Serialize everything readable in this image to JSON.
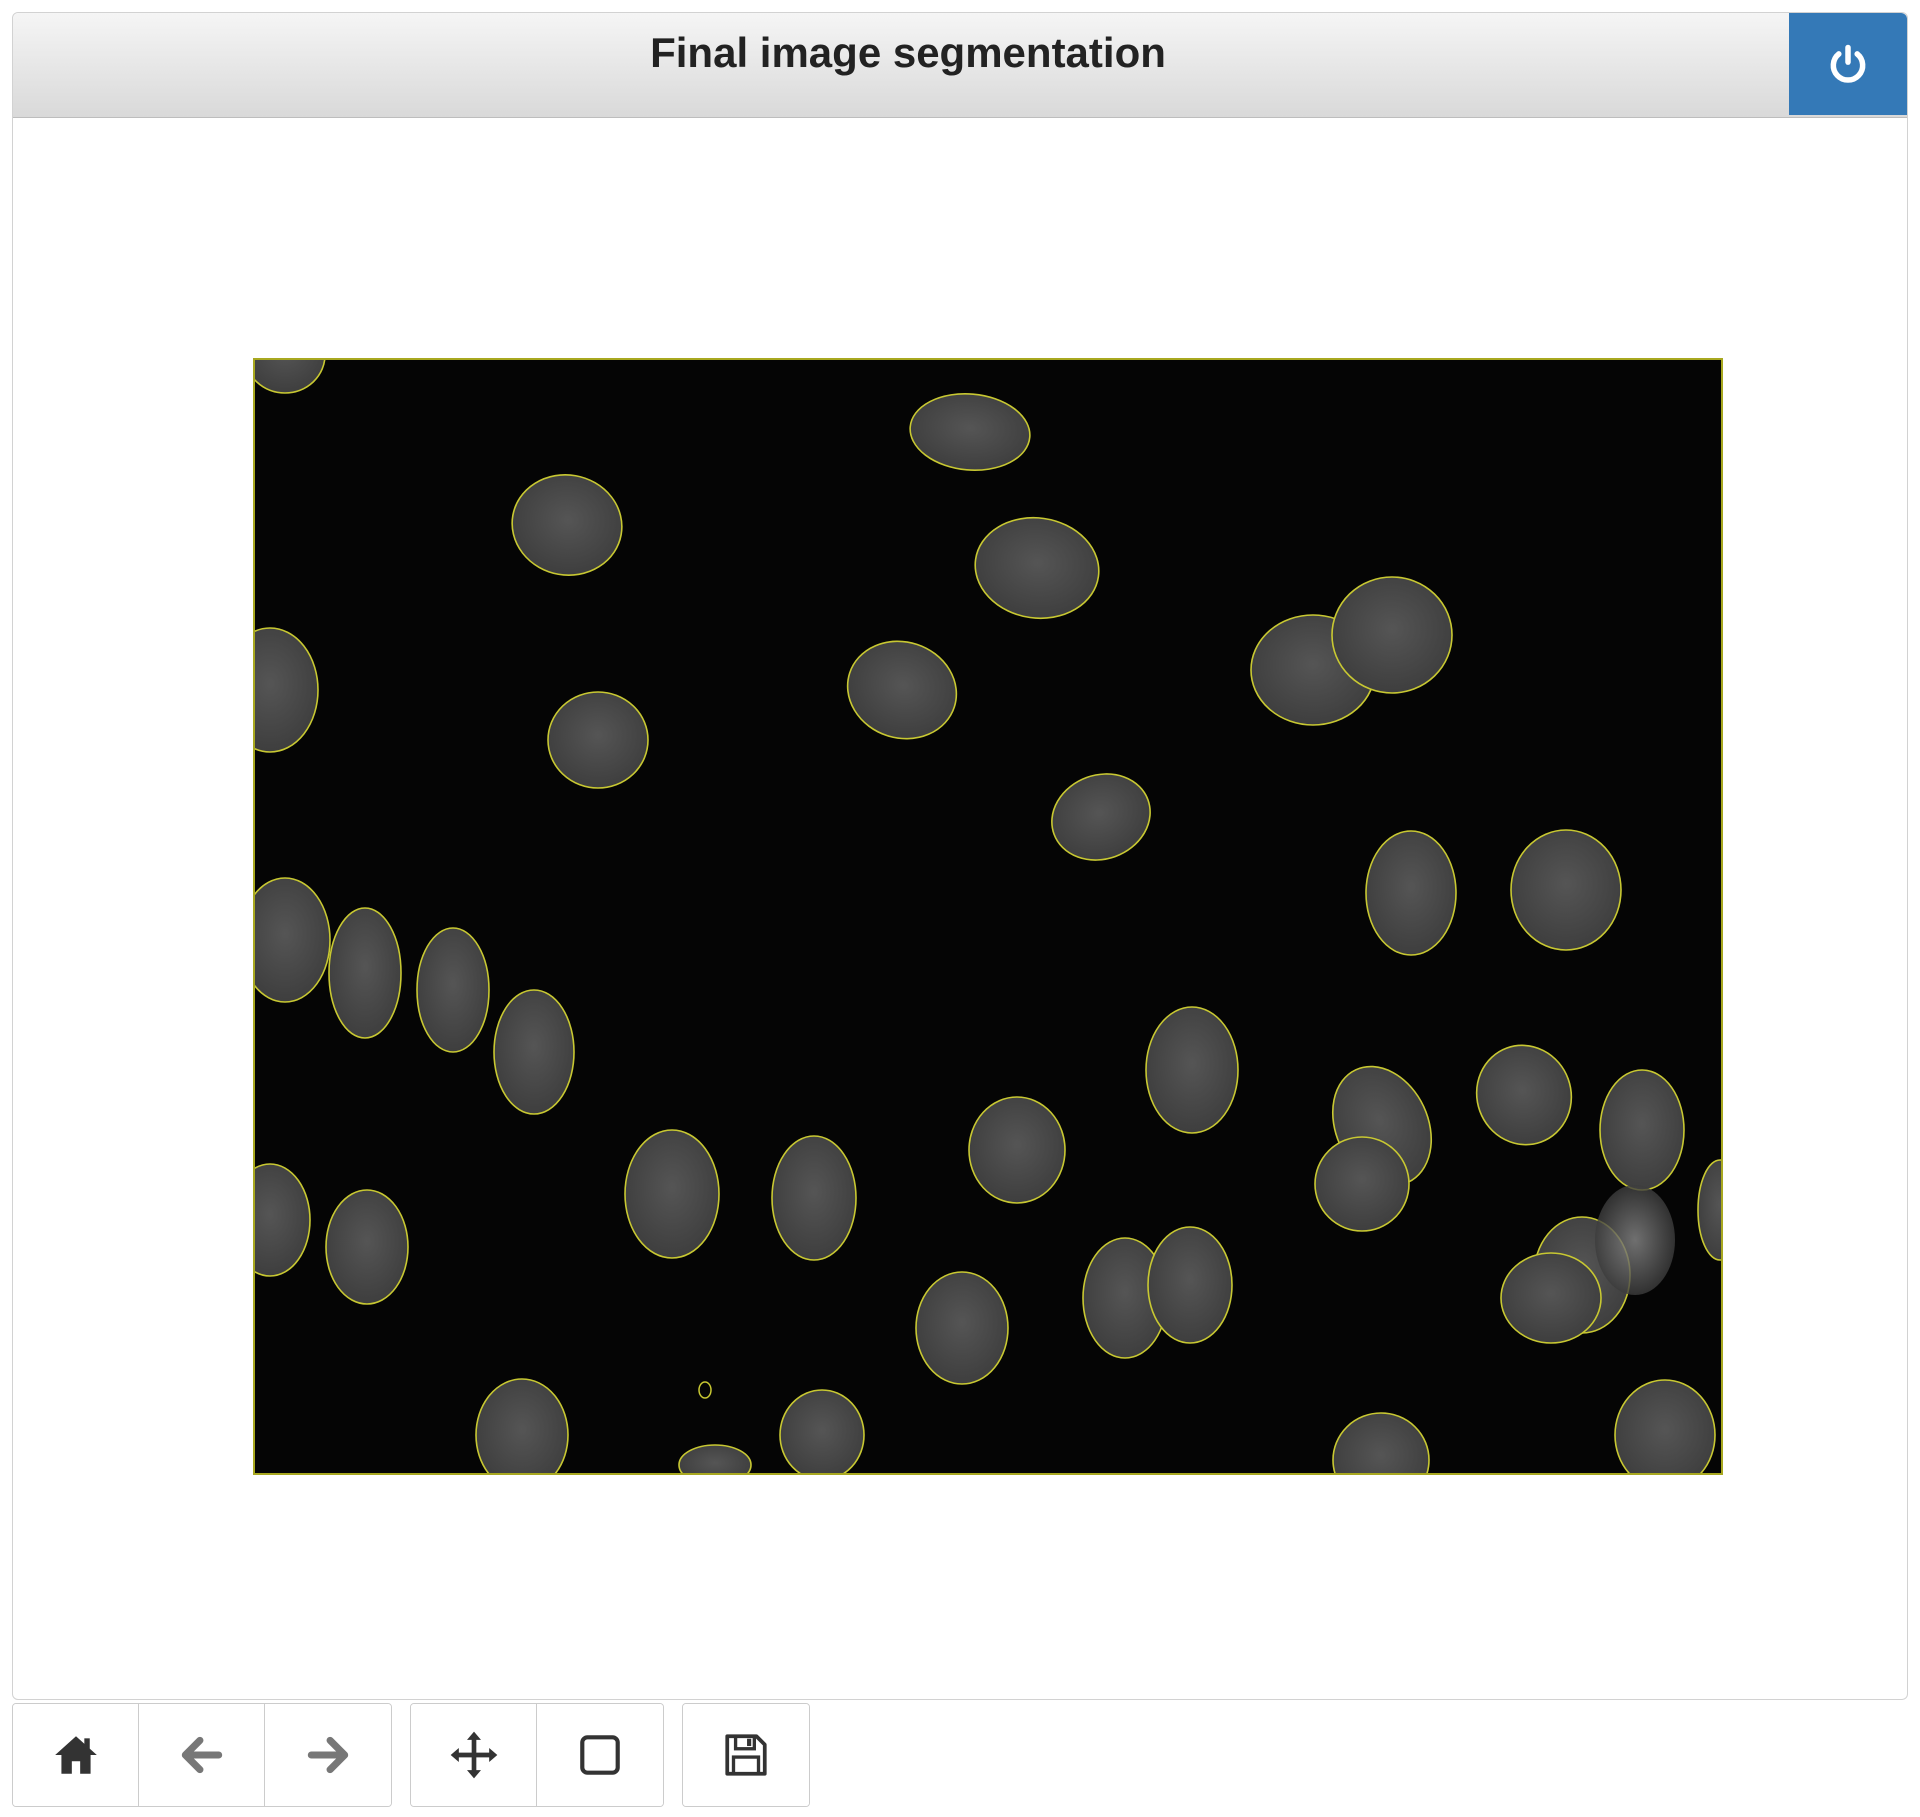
{
  "window": {
    "title": "Final image segmentation"
  },
  "header": {
    "close_icon": "power-icon",
    "accent_color": "#3479b7"
  },
  "figure": {
    "background_color": "#050505",
    "contour_color": "#c8c832",
    "nucleus_color": "#4a4a4a"
  },
  "toolbar": {
    "groups": [
      [
        "home-icon",
        "arrow-left-icon",
        "arrow-right-icon"
      ],
      [
        "move-icon",
        "zoom-rect-icon"
      ],
      [
        "save-icon"
      ]
    ]
  }
}
